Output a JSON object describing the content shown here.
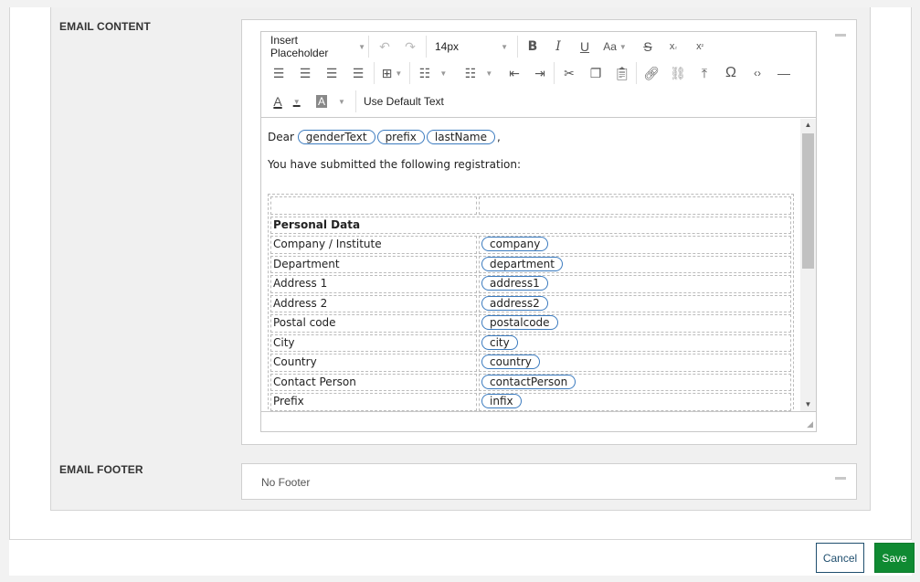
{
  "email_content": {
    "label": "EMAIL CONTENT",
    "toolbar": {
      "insert_placeholder_label": "Insert Placeholder",
      "font_size_value": "14px",
      "case_label": "Aa",
      "use_default_text_label": "Use Default Text"
    },
    "body": {
      "greeting_prefix": "Dear",
      "greeting_placeholders": [
        "genderText",
        "prefix",
        "lastName"
      ],
      "greeting_suffix": ",",
      "intro": "You have submitted the following registration:",
      "section_heading": "Personal Data",
      "rows": [
        {
          "label": "Company / Institute",
          "placeholder": "company"
        },
        {
          "label": "Department",
          "placeholder": "department"
        },
        {
          "label": "Address 1",
          "placeholder": "address1"
        },
        {
          "label": "Address 2",
          "placeholder": "address2"
        },
        {
          "label": "Postal code",
          "placeholder": "postalcode"
        },
        {
          "label": "City",
          "placeholder": "city"
        },
        {
          "label": "Country",
          "placeholder": "country"
        },
        {
          "label": "Contact Person",
          "placeholder": "contactPerson"
        },
        {
          "label": "Prefix",
          "placeholder": "infix"
        }
      ]
    }
  },
  "email_footer": {
    "label": "EMAIL FOOTER",
    "value": "No Footer"
  },
  "actions": {
    "cancel_label": "Cancel",
    "save_label": "Save"
  },
  "colors": {
    "save_bg": "#0f8a32",
    "cancel_border": "#1f4e6e",
    "placeholder_border": "#3b7bbf"
  }
}
